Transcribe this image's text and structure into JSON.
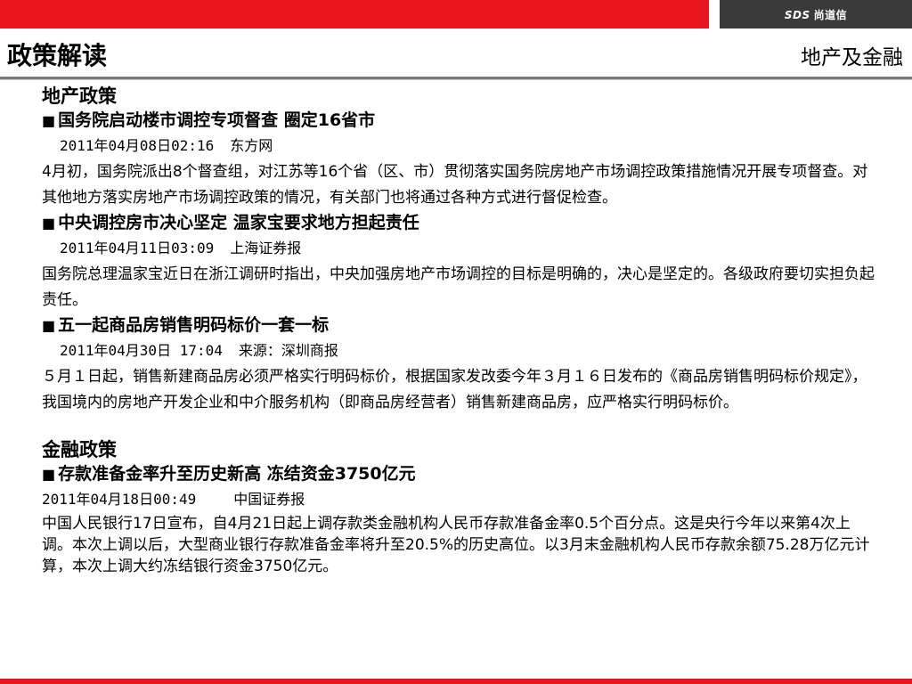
{
  "brand": {
    "logo_text": "尚道信",
    "logo_mark": "SDS"
  },
  "header": {
    "title": "政策解读",
    "subtitle": "地产及金融"
  },
  "sections": [
    {
      "title": "地产政策",
      "items": [
        {
          "headline": "国务院启动楼市调控专项督查 圈定16省市",
          "date": "2011年04月08日02:16",
          "source": "东方网",
          "body": "4月初，国务院派出8个督查组，对江苏等16个省（区、市）贯彻落实国务院房地产市场调控政策措施情况开展专项督查。对其他地方落实房地产市场调控政策的情况，有关部门也将通过各种方式进行督促检查。"
        },
        {
          "headline": "中央调控房市决心坚定 温家宝要求地方担起责任",
          "date": "2011年04月11日03:09",
          "source": "上海证券报",
          "body": "国务院总理温家宝近日在浙江调研时指出，中央加强房地产市场调控的目标是明确的，决心是坚定的。各级政府要切实担负起责任。"
        },
        {
          "headline": "五一起商品房销售明码标价一套一标",
          "date": "2011年04月30日 17:04",
          "source": "来源：深圳商报",
          "body": "５月１日起，销售新建商品房必须严格实行明码标价，根据国家发改委今年３月１６日发布的《商品房销售明码标价规定》，我国境内的房地产开发企业和中介服务机构（即商品房经营者）销售新建商品房，应严格实行明码标价。"
        }
      ]
    },
    {
      "title": "金融政策",
      "items": [
        {
          "headline": "存款准备金率升至历史新高 冻结资金3750亿元",
          "date": "2011年04月18日00:49",
          "source": "中国证券报",
          "body": "中国人民银行17日宣布，自4月21日起上调存款类金融机构人民币存款准备金率0.5个百分点。这是央行今年以来第4次上调。本次上调以后，大型商业银行存款准备金率将升至20.5%的历史高位。以3月末金融机构人民币存款余额75.28万亿元计算，本次上调大约冻结银行资金3750亿元。"
        }
      ]
    }
  ],
  "colors": {
    "accent": "#e8141e",
    "logo_bg": "#3a3a3a",
    "rule": "#7a7a7a"
  },
  "icons": {
    "bullet": "black-square"
  }
}
